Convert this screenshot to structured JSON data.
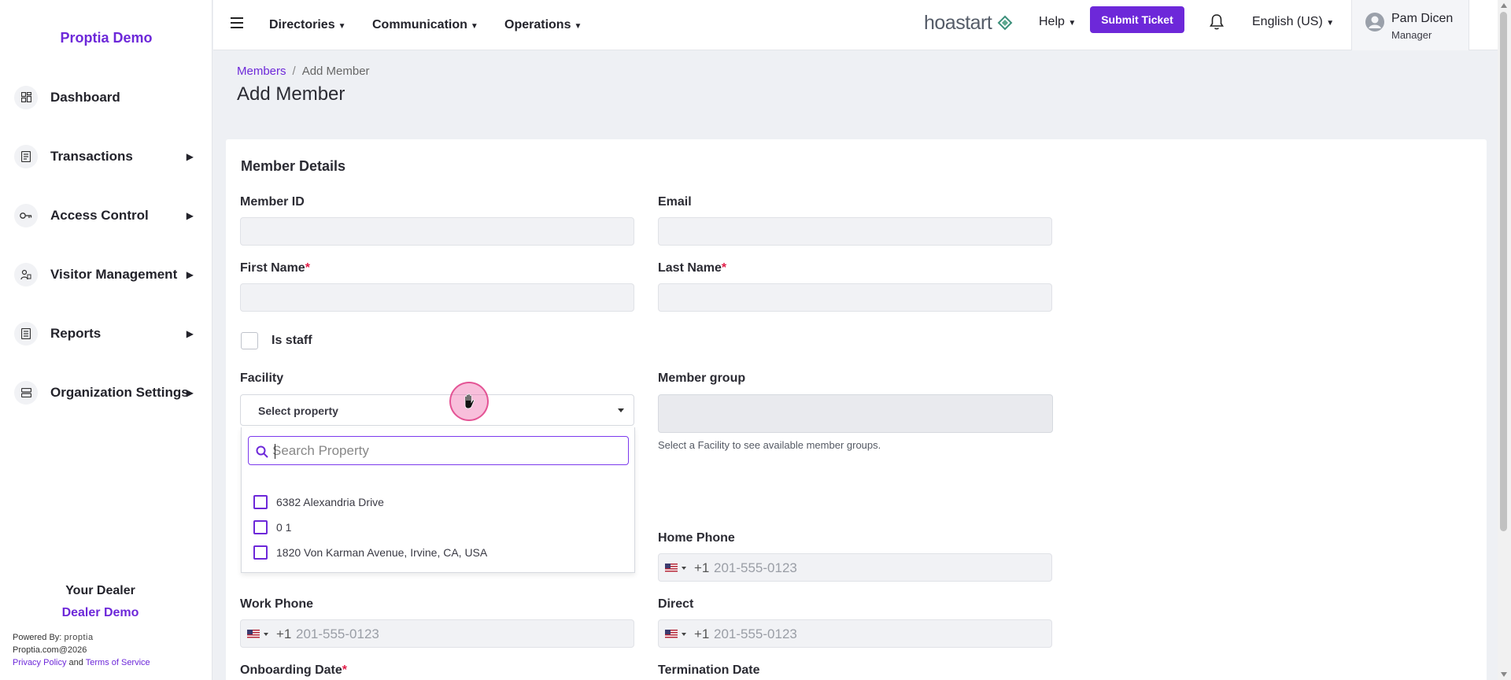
{
  "sidebar": {
    "brand": "Proptia Demo",
    "items": [
      {
        "label": "Dashboard",
        "icon": "dashboard-icon",
        "has_children": false
      },
      {
        "label": "Transactions",
        "icon": "document-icon",
        "has_children": true
      },
      {
        "label": "Access Control",
        "icon": "key-icon",
        "has_children": true
      },
      {
        "label": "Visitor Management",
        "icon": "visitor-icon",
        "has_children": true
      },
      {
        "label": "Reports",
        "icon": "report-icon",
        "has_children": true
      },
      {
        "label": "Organization Settings",
        "icon": "server-icon",
        "has_children": true
      }
    ],
    "dealer_heading": "Your Dealer",
    "dealer_name": "Dealer Demo",
    "powered_by": "Powered By:",
    "powered_logo": "proptia",
    "copyright": "Proptia.com@2026",
    "privacy": "Privacy Policy",
    "and": "and",
    "terms": "Terms of Service"
  },
  "topbar": {
    "menus": [
      "Directories",
      "Communication",
      "Operations"
    ],
    "logo_text": "hoastart",
    "help": "Help",
    "submit_ticket": "Submit Ticket",
    "language": "English (US)",
    "user_name": "Pam Dicen",
    "user_role": "Manager"
  },
  "breadcrumb": {
    "parent": "Members",
    "current": "Add Member"
  },
  "page_title": "Add Member",
  "form": {
    "section_title": "Member Details",
    "member_id_label": "Member ID",
    "email_label": "Email",
    "first_name_label": "First Name",
    "last_name_label": "Last Name",
    "required_mark": "*",
    "is_staff_label": "Is staff",
    "facility_label": "Facility",
    "facility_value": "Select property",
    "member_group_label": "Member group",
    "member_group_hint": "Select a Facility to see available member groups.",
    "home_phone_label": "Home Phone",
    "work_phone_label": "Work Phone",
    "direct_label": "Direct",
    "onboarding_label": "Onboarding Date",
    "termination_label": "Termination Date",
    "phone_code": "+1",
    "phone_placeholder": "201-555-0123"
  },
  "dropdown": {
    "search_placeholder": "Search Property",
    "options": [
      "6382 Alexandria Drive",
      "0 1",
      "1820 Von Karman Avenue, Irvine, CA, USA"
    ]
  },
  "colors": {
    "accent": "#6d28d9",
    "required": "#e11d48"
  }
}
